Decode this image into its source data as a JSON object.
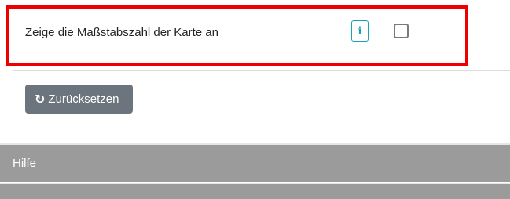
{
  "setting": {
    "label": "Zeige die Maßstabszahl der Karte an",
    "info_icon": "info-icon",
    "checkbox_checked": false
  },
  "reset_button": {
    "label": "Zurücksetzen",
    "icon": "refresh-icon"
  },
  "sections": {
    "help": "Hilfe"
  },
  "colors": {
    "highlight": "#ee0000",
    "info": "#17a2b8",
    "button_bg": "#6c757d",
    "section_bg": "#9b9b9b"
  }
}
